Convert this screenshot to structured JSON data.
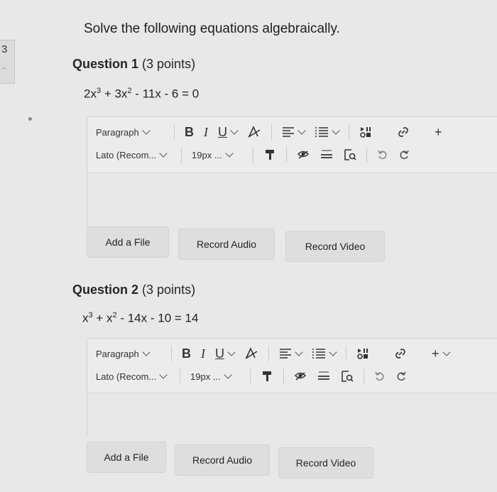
{
  "sidebar_tab": {
    "number": "3",
    "dash": "--"
  },
  "page": {
    "heading": "Solve the following equations algebraically."
  },
  "questions": [
    {
      "title": "Question 1",
      "points": "(3 points)",
      "equation": {
        "a": "2x",
        "e1": "3",
        "b": " + 3x",
        "e2": "2",
        "c": " - 11x - 6 = 0"
      },
      "toolbar": {
        "paragraph": "Paragraph",
        "font": "Lato (Recom...",
        "size": "19px ...",
        "bold": "B",
        "italic": "I",
        "underline": "U",
        "plus": "+"
      },
      "buttons": {
        "file": "Add a File",
        "audio": "Record Audio",
        "video": "Record Video"
      }
    },
    {
      "title": "Question 2",
      "points": "(3 points)",
      "equation": {
        "a": "x",
        "e1": "3",
        "b": " + x",
        "e2": "2",
        "c": " - 14x - 10 = 14"
      },
      "toolbar": {
        "paragraph": "Paragraph",
        "font": "Lato (Recom...",
        "size": "19px ...",
        "bold": "B",
        "italic": "I",
        "underline": "U",
        "plus": "+"
      },
      "buttons": {
        "file": "Add a File",
        "audio": "Record Audio",
        "video": "Record Video"
      }
    }
  ]
}
